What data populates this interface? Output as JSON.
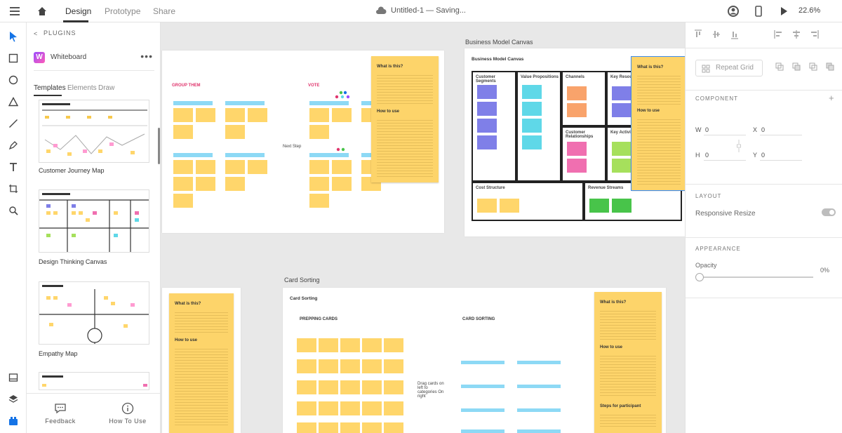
{
  "topbar": {
    "tabs": [
      {
        "label": "Design"
      },
      {
        "label": "Prototype"
      },
      {
        "label": "Share"
      }
    ],
    "doc_title": "Untitled-1  —  Saving...",
    "zoom": "22.6%"
  },
  "plugins": {
    "header": "PLUGINS",
    "plugin_name": "Whiteboard",
    "more": "•••",
    "tabs": [
      "Templates",
      "Elements",
      "Draw"
    ],
    "templates": [
      {
        "label": "Customer Journey Map"
      },
      {
        "label": "Design Thinking Canvas"
      },
      {
        "label": "Empathy Map"
      }
    ],
    "bottom": {
      "feedback": "Feedback",
      "how_to_use": "How To Use"
    }
  },
  "canvas": {
    "artboards": {
      "bmc_label": "Business Model Canvas",
      "card_label": "Card Sorting"
    },
    "group_them": "GROUP THEM",
    "vote": "VOTE",
    "next_step": "Next Step",
    "bmc_title": "Business Model Canvas",
    "bmc_cells": [
      "Customer Segments",
      "Value Propositions",
      "Channels",
      "Key Resources",
      "Customer Relationships",
      "Key Activities",
      "Cost Structure",
      "Revenue Streams"
    ],
    "note_title": "What is this?",
    "note_sub": "How to use",
    "card_title": "Card Sorting",
    "prepping": "PREPPING CARDS",
    "card_sorting": "CARD SORTING",
    "drag_text": "Drag cards on left to categories On right",
    "steps_title": "Steps for participant"
  },
  "props": {
    "repeat_grid": "Repeat Grid",
    "component": "COMPONENT",
    "w_label": "W",
    "w_val": "0",
    "x_label": "X",
    "x_val": "0",
    "h_label": "H",
    "h_val": "0",
    "y_label": "Y",
    "y_val": "0",
    "layout": "LAYOUT",
    "responsive": "Responsive Resize",
    "appearance": "APPEARANCE",
    "opacity_label": "Opacity",
    "opacity_val": "0%"
  },
  "colors": {
    "accent": "#1473e6",
    "sticky": "#ffd66b",
    "note": "#fdd46a"
  }
}
